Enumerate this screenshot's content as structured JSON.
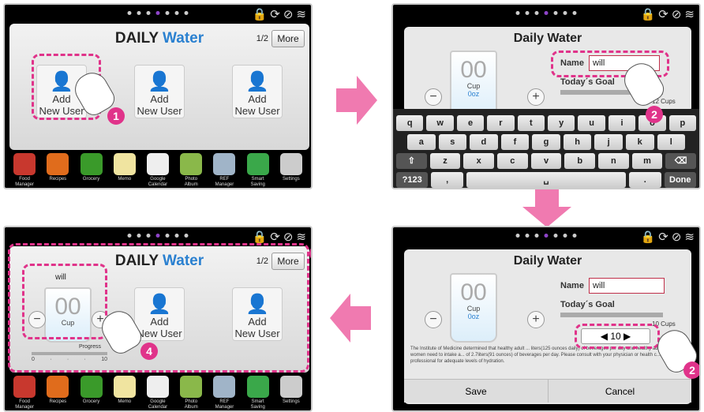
{
  "status_icons": [
    "lock-icon",
    "sync-icon",
    "no-sign-icon",
    "wifi-icon"
  ],
  "home": {
    "title_a": "DAILY",
    "title_b": "Water",
    "page": "1/2",
    "more": "More",
    "slot_label": "Add\nNew User"
  },
  "apps": [
    {
      "label": "Food\nManager",
      "color": "#c8382e"
    },
    {
      "label": "Recipes",
      "color": "#e06c1c"
    },
    {
      "label": "Grocery",
      "color": "#3a9a2a"
    },
    {
      "label": "Memo",
      "color": "#f0e4a0"
    },
    {
      "label": "Google\nCalendar",
      "color": "#eeeeee"
    },
    {
      "label": "Photo\nAlbum",
      "color": "#8ab84a"
    },
    {
      "label": "REF\nManager",
      "color": "#a0b4c8"
    },
    {
      "label": "Smart\nSaving",
      "color": "#3aa84a"
    },
    {
      "label": "Settings",
      "color": "#cccccc"
    }
  ],
  "dialog": {
    "title": "Daily Water",
    "name_label": "Name",
    "name_value": "will",
    "goal_label": "Today´s Goal",
    "cups_unit": "12 Cups",
    "cups_unit2": "10 Cups",
    "glass_num": "00",
    "glass_unit": "Cup",
    "glass_oz": "0oz",
    "goal_value": "10",
    "save": "Save",
    "cancel": "Cancel",
    "info": "The Institute of Medicine determined that healthy adult ... liters(125 ounces daily) of beverages per day and healthy adult women need to intake a... of 2.7liters(91 ounces) of beverages per day. Please consult with your physician or health c... professional for adequate levels of hydration.",
    "under_labels": [
      "Manager",
      "Calendar",
      "Album",
      "Manager",
      "Saving"
    ]
  },
  "keyboard": {
    "row1": [
      "q",
      "w",
      "e",
      "r",
      "t",
      "y",
      "u",
      "i",
      "o",
      "p"
    ],
    "row2": [
      "a",
      "s",
      "d",
      "f",
      "g",
      "h",
      "j",
      "k",
      "l"
    ],
    "row3": [
      "⇧",
      "z",
      "x",
      "c",
      "v",
      "b",
      "n",
      "m",
      "⌫"
    ],
    "row4": [
      "?123",
      ",",
      "␣",
      ".",
      "Done"
    ]
  },
  "user": {
    "name": "will",
    "num": "00",
    "unit": "Cup",
    "progress_label": "Progress",
    "progress_ticks": [
      "0",
      "·",
      "·",
      "·",
      "10"
    ]
  },
  "steps": [
    "1",
    "2",
    "2",
    "3",
    "4"
  ]
}
